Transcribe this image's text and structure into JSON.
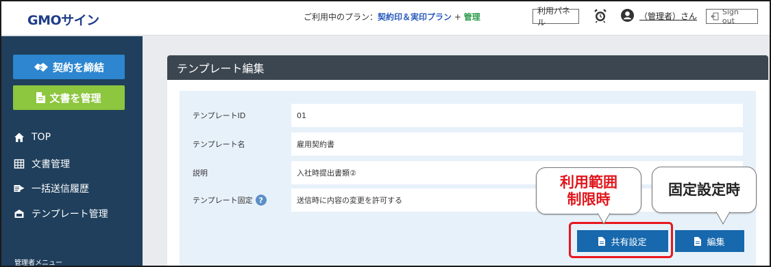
{
  "header": {
    "logo": "GMOサイン",
    "plan_prefix": "ご利用中のプラン：",
    "plan_name": "契約印＆実印プラン",
    "plan_plus": " + ",
    "plan_admin": "管理",
    "panel_button": "利用パネル",
    "user_label": "（管理者）さん",
    "signout_label": "Sign out"
  },
  "sidebar": {
    "contract_button": "契約を締結",
    "manage_button": "文書を管理",
    "items": [
      {
        "label": "TOP",
        "icon": "home-icon"
      },
      {
        "label": "文書管理",
        "icon": "table-icon"
      },
      {
        "label": "一括送信履歴",
        "icon": "bulk-send-icon"
      },
      {
        "label": "テンプレート管理",
        "icon": "template-icon"
      }
    ],
    "admin_menu": "管理者メニュー"
  },
  "main": {
    "title": "テンプレート編集",
    "fields": [
      {
        "label": "テンプレートID",
        "value": "01"
      },
      {
        "label": "テンプレート名",
        "value": "雇用契約書"
      },
      {
        "label": "説明",
        "value": "入社時提出書類②"
      },
      {
        "label": "テンプレート固定",
        "value": "送信時に内容の変更を許可する"
      }
    ],
    "help_glyph": "?",
    "share_button": "共有設定",
    "edit_button": "編集"
  },
  "callouts": {
    "usage_line1": "利用範囲",
    "usage_line2": "制限時",
    "fixed": "固定設定時"
  },
  "colors": {
    "brand": "#1f3d8a",
    "sidebar_bg": "#1f3f5c",
    "contract_btn": "#2d86cf",
    "manage_btn": "#8dc63f",
    "action_btn": "#1768ad",
    "highlight": "#e8151c"
  }
}
